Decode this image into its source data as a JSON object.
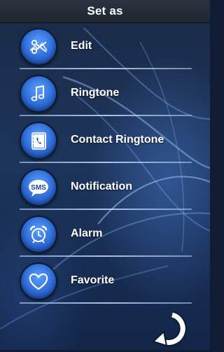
{
  "header": {
    "title": "Set as"
  },
  "menu": {
    "items": [
      {
        "label": "Edit",
        "icon": "scissors-icon"
      },
      {
        "label": "Ringtone",
        "icon": "music-note-icon"
      },
      {
        "label": "Contact Ringtone",
        "icon": "contact-book-icon"
      },
      {
        "label": "Notification",
        "icon": "sms-icon"
      },
      {
        "label": "Alarm",
        "icon": "alarm-clock-icon"
      },
      {
        "label": "Favorite",
        "icon": "heart-icon"
      }
    ]
  },
  "footer": {
    "icon": "refresh-icon"
  },
  "colors": {
    "icon_fill": "#2d6ad6",
    "background": "#1d355b",
    "header": "#252d38"
  }
}
